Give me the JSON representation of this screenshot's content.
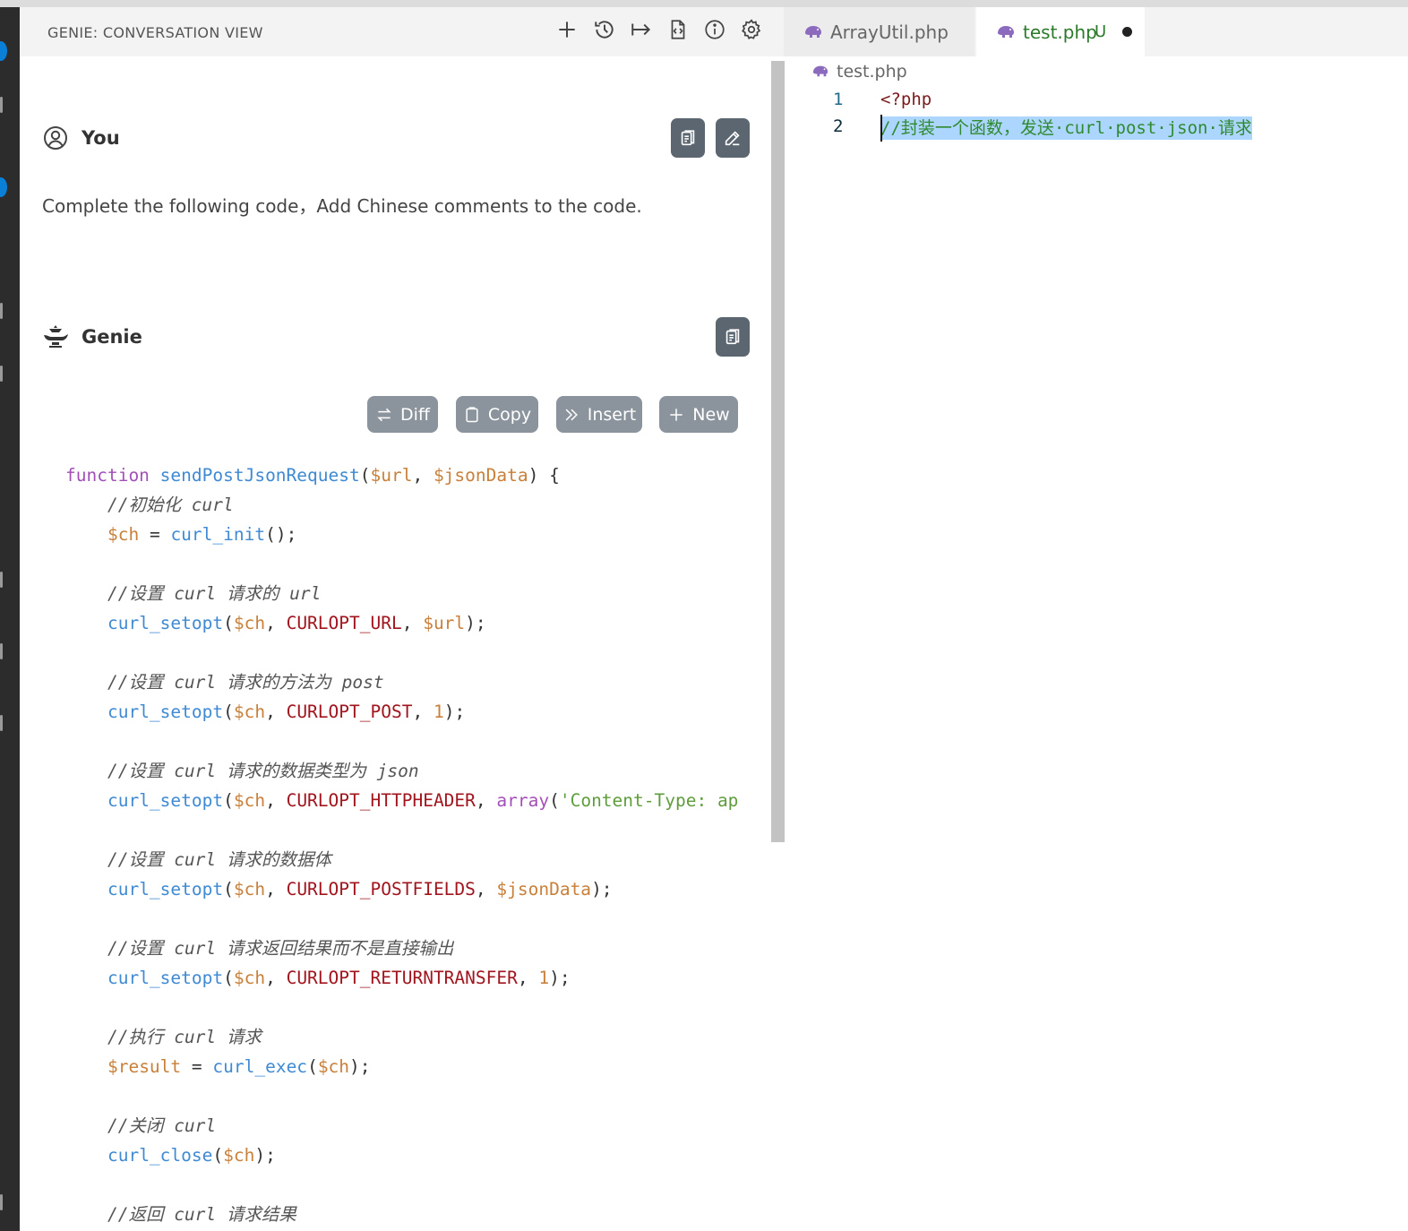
{
  "panel": {
    "title": "GENIE: CONVERSATION VIEW",
    "toolbar_icons": [
      "plus-icon",
      "history-icon",
      "arrow-right-to-bar-icon",
      "file-code-icon",
      "info-icon",
      "gear-icon"
    ]
  },
  "tabs": [
    {
      "label": "ArrayUtil.php",
      "icon": "php-elephant-icon"
    },
    {
      "label": "test.php",
      "status": "U",
      "modified": true,
      "icon": "php-elephant-icon"
    }
  ],
  "conversation": {
    "user": {
      "name": "You",
      "message": "Complete the following code，Add Chinese comments to the code."
    },
    "assistant": {
      "name": "Genie"
    },
    "actions": [
      "Diff",
      "Copy",
      "Insert",
      "New"
    ]
  },
  "code_lines": [
    [
      [
        "kw",
        "function"
      ],
      [
        "pn",
        " "
      ],
      [
        "fn",
        "sendPostJsonRequest"
      ],
      [
        "pn",
        "("
      ],
      [
        "var",
        "$url"
      ],
      [
        "pn",
        ", "
      ],
      [
        "var",
        "$jsonData"
      ],
      [
        "pn",
        ") {"
      ]
    ],
    [
      [
        "pn",
        "    "
      ],
      [
        "cm",
        "//初始化 curl"
      ]
    ],
    [
      [
        "pn",
        "    "
      ],
      [
        "var",
        "$ch"
      ],
      [
        "pn",
        " = "
      ],
      [
        "fn",
        "curl_init"
      ],
      [
        "pn",
        "();"
      ]
    ],
    [],
    [
      [
        "pn",
        "    "
      ],
      [
        "cm",
        "//设置 curl 请求的 url"
      ]
    ],
    [
      [
        "pn",
        "    "
      ],
      [
        "fn",
        "curl_setopt"
      ],
      [
        "pn",
        "("
      ],
      [
        "var",
        "$ch"
      ],
      [
        "pn",
        ", "
      ],
      [
        "const",
        "CURLOPT_URL"
      ],
      [
        "pn",
        ", "
      ],
      [
        "var",
        "$url"
      ],
      [
        "pn",
        ");"
      ]
    ],
    [],
    [
      [
        "pn",
        "    "
      ],
      [
        "cm",
        "//设置 curl 请求的方法为 post"
      ]
    ],
    [
      [
        "pn",
        "    "
      ],
      [
        "fn",
        "curl_setopt"
      ],
      [
        "pn",
        "("
      ],
      [
        "var",
        "$ch"
      ],
      [
        "pn",
        ", "
      ],
      [
        "const",
        "CURLOPT_POST"
      ],
      [
        "pn",
        ", "
      ],
      [
        "num",
        "1"
      ],
      [
        "pn",
        ");"
      ]
    ],
    [],
    [
      [
        "pn",
        "    "
      ],
      [
        "cm",
        "//设置 curl 请求的数据类型为 json"
      ]
    ],
    [
      [
        "pn",
        "    "
      ],
      [
        "fn",
        "curl_setopt"
      ],
      [
        "pn",
        "("
      ],
      [
        "var",
        "$ch"
      ],
      [
        "pn",
        ", "
      ],
      [
        "const",
        "CURLOPT_HTTPHEADER"
      ],
      [
        "pn",
        ", "
      ],
      [
        "kw",
        "array"
      ],
      [
        "pn",
        "("
      ],
      [
        "str",
        "'Content-Type: ap"
      ]
    ],
    [],
    [
      [
        "pn",
        "    "
      ],
      [
        "cm",
        "//设置 curl 请求的数据体"
      ]
    ],
    [
      [
        "pn",
        "    "
      ],
      [
        "fn",
        "curl_setopt"
      ],
      [
        "pn",
        "("
      ],
      [
        "var",
        "$ch"
      ],
      [
        "pn",
        ", "
      ],
      [
        "const",
        "CURLOPT_POSTFIELDS"
      ],
      [
        "pn",
        ", "
      ],
      [
        "var",
        "$jsonData"
      ],
      [
        "pn",
        ");"
      ]
    ],
    [],
    [
      [
        "pn",
        "    "
      ],
      [
        "cm",
        "//设置 curl 请求返回结果而不是直接输出"
      ]
    ],
    [
      [
        "pn",
        "    "
      ],
      [
        "fn",
        "curl_setopt"
      ],
      [
        "pn",
        "("
      ],
      [
        "var",
        "$ch"
      ],
      [
        "pn",
        ", "
      ],
      [
        "const",
        "CURLOPT_RETURNTRANSFER"
      ],
      [
        "pn",
        ", "
      ],
      [
        "num",
        "1"
      ],
      [
        "pn",
        ");"
      ]
    ],
    [],
    [
      [
        "pn",
        "    "
      ],
      [
        "cm",
        "//执行 curl 请求"
      ]
    ],
    [
      [
        "pn",
        "    "
      ],
      [
        "var",
        "$result"
      ],
      [
        "pn",
        " = "
      ],
      [
        "fn",
        "curl_exec"
      ],
      [
        "pn",
        "("
      ],
      [
        "var",
        "$ch"
      ],
      [
        "pn",
        ");"
      ]
    ],
    [],
    [
      [
        "pn",
        "    "
      ],
      [
        "cm",
        "//关闭 curl"
      ]
    ],
    [
      [
        "pn",
        "    "
      ],
      [
        "fn",
        "curl_close"
      ],
      [
        "pn",
        "("
      ],
      [
        "var",
        "$ch"
      ],
      [
        "pn",
        ");"
      ]
    ],
    [],
    [
      [
        "pn",
        "    "
      ],
      [
        "cm",
        "//返回 curl 请求结果"
      ]
    ]
  ],
  "editor": {
    "breadcrumb": "test.php",
    "lines": [
      {
        "number": "1",
        "text": "<?php"
      },
      {
        "number": "2",
        "text": "//封装一个函数，发送·curl·post·json·请求"
      }
    ]
  }
}
